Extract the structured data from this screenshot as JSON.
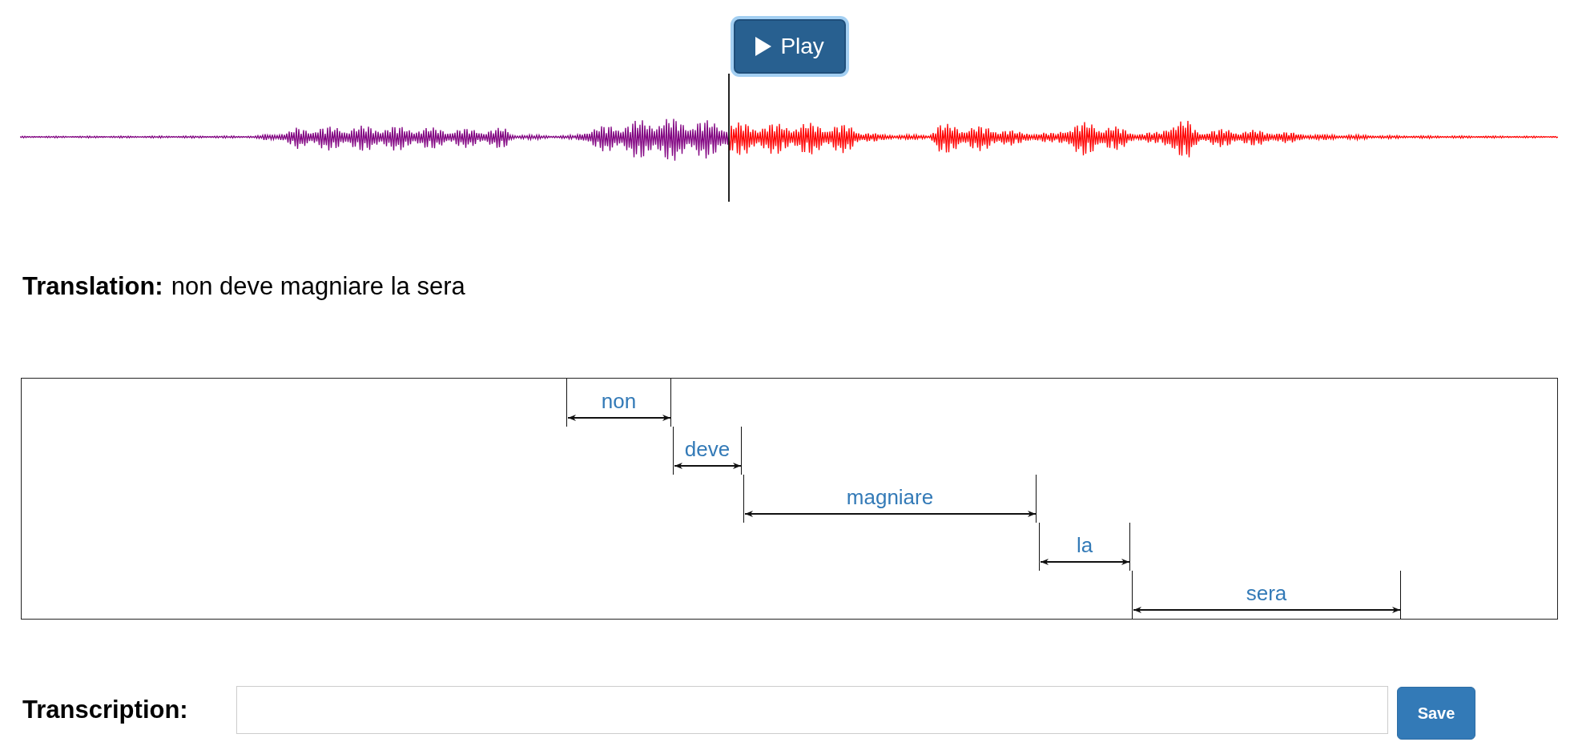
{
  "player": {
    "button": "Play",
    "focused": true,
    "level": 0.461
  },
  "translation": {
    "label": "Translation:",
    "text": "non deve magniare la sera"
  },
  "alignment": {
    "words": [
      {
        "label": "non"
      },
      {
        "label": "deve"
      },
      {
        "label": "magniare"
      },
      {
        "label": "la"
      },
      {
        "label": "sera"
      }
    ]
  },
  "transcription": {
    "label": "Transcription:",
    "button": "Save"
  }
}
